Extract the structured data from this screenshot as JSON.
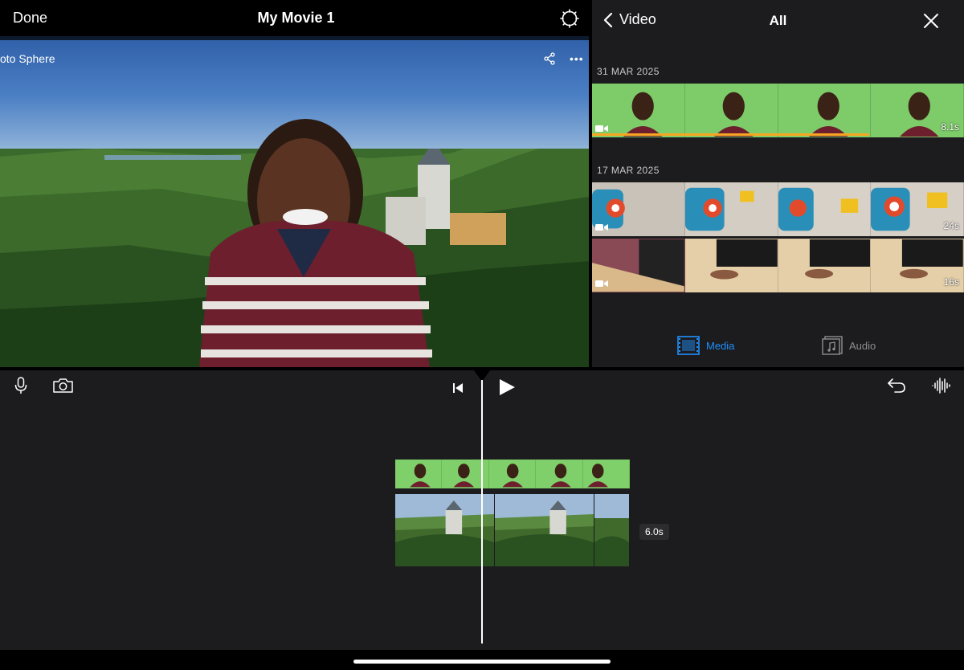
{
  "topbar": {
    "done_label": "Done",
    "title": "My Movie 1",
    "settings_icon": "gear-icon"
  },
  "viewer": {
    "overlay_text": "oto Sphere",
    "share_icon": "share-icon",
    "more_label": "•••"
  },
  "browser": {
    "back_label": "Video",
    "title": "All",
    "close_icon": "close-icon",
    "sections": [
      {
        "date": "31 MAR 2025",
        "clips": [
          {
            "duration": "8.1s"
          }
        ]
      },
      {
        "date": "17 MAR 2025",
        "clips": [
          {
            "duration": "24s"
          },
          {
            "duration": "16s"
          }
        ]
      }
    ],
    "tabs": {
      "media_label": "Media",
      "audio_label": "Audio"
    },
    "colors": {
      "accent": "#1e90ff",
      "inactive": "#8e8e93",
      "used_marker": "#f6a623"
    }
  },
  "timeline": {
    "duration_badge": "6.0s",
    "icons": [
      "microphone-icon",
      "camera-icon",
      "skip-to-start-icon",
      "play-icon",
      "undo-icon",
      "waveform-icon"
    ]
  }
}
